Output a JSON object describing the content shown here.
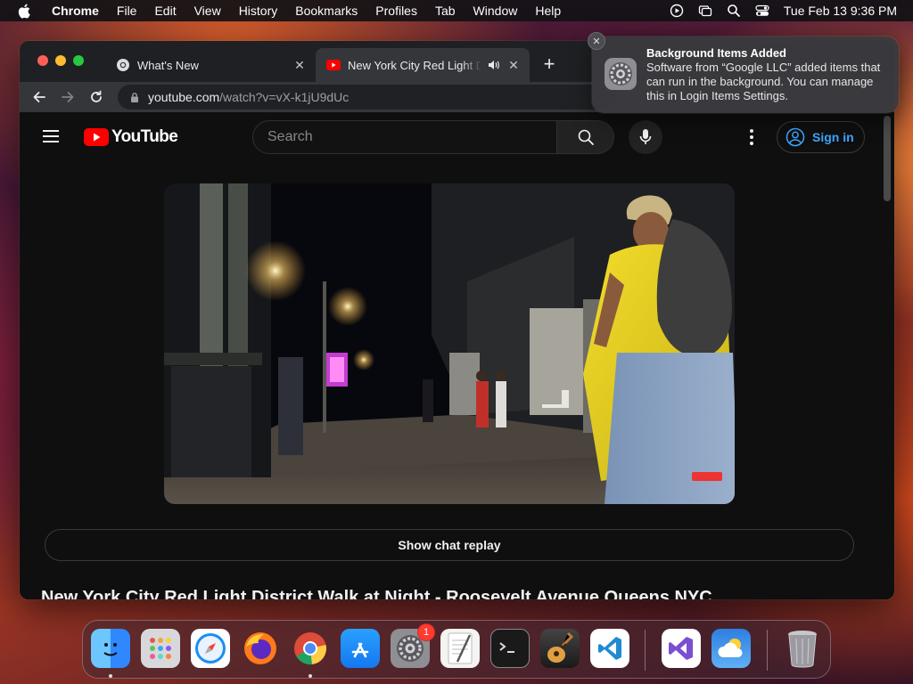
{
  "menubar": {
    "app_name": "Chrome",
    "items": [
      "File",
      "Edit",
      "View",
      "History",
      "Bookmarks",
      "Profiles",
      "Tab",
      "Window",
      "Help"
    ],
    "clock": "Tue Feb 13  9:36 PM"
  },
  "browser": {
    "tabs": [
      {
        "title": "What's New",
        "icon": "chrome-icon"
      },
      {
        "title": "New York City Red Light District Walk at Night - Roosevelt Avenue Queens NYC",
        "icon": "youtube-icon",
        "audio": true
      }
    ],
    "url_host": "youtube.com",
    "url_path": "/watch?v=vX-k1jU9dUc"
  },
  "youtube": {
    "logo_text": "YouTube",
    "search_placeholder": "Search",
    "sign_in_label": "Sign in",
    "chat_replay_label": "Show chat replay",
    "video_title": "New York City Red Light District Walk at Night - Roosevelt Avenue Queens NYC"
  },
  "notification": {
    "title": "Background Items Added",
    "body": "Software from “Google LLC” added items that can run in the background. You can manage this in Login Items Settings."
  },
  "dock": {
    "apps": [
      {
        "name": "Finder",
        "icon": "finder-icon",
        "running": true
      },
      {
        "name": "Launchpad",
        "icon": "launchpad-icon",
        "running": false
      },
      {
        "name": "Safari",
        "icon": "safari-icon",
        "running": false
      },
      {
        "name": "Firefox",
        "icon": "firefox-icon",
        "running": false
      },
      {
        "name": "Chrome",
        "icon": "chrome-icon",
        "running": true
      },
      {
        "name": "App Store",
        "icon": "app-store-icon",
        "running": false
      },
      {
        "name": "System Settings",
        "icon": "settings-icon",
        "badge": "1",
        "running": false
      },
      {
        "name": "TextEdit",
        "icon": "textedit-icon",
        "running": false
      },
      {
        "name": "Terminal",
        "icon": "terminal-icon",
        "running": false
      },
      {
        "name": "GarageBand",
        "icon": "garageband-icon",
        "running": false
      },
      {
        "name": "Visual Studio Code",
        "icon": "vscode-icon",
        "running": false
      },
      {
        "name": "Visual Studio",
        "icon": "visual-studio-icon",
        "running": false
      },
      {
        "name": "Weather",
        "icon": "weather-icon",
        "running": false
      },
      {
        "name": "Trash",
        "icon": "trash-icon",
        "running": false
      }
    ]
  },
  "colors": {
    "youtube_red": "#ff0000",
    "link_blue": "#3ea6ff",
    "badge_red": "#ff3b30"
  }
}
